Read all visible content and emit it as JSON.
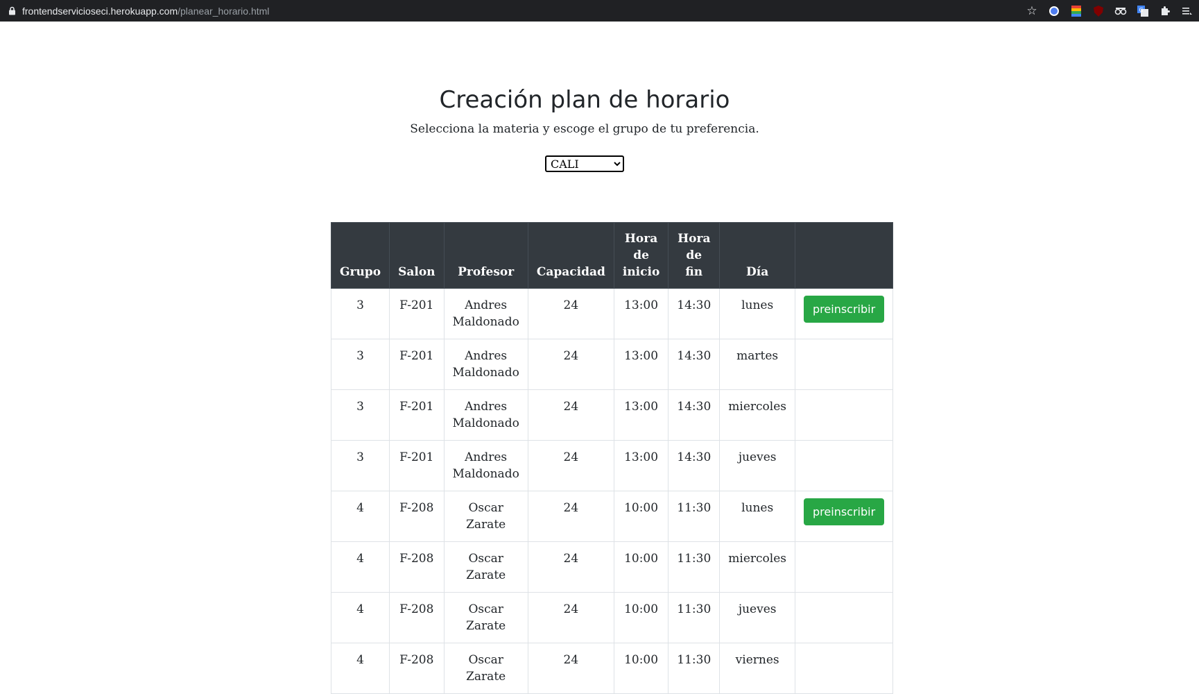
{
  "browser": {
    "url_host": "frontendservicioseci.herokuapp.com",
    "url_path": "/planear_horario.html"
  },
  "header": {
    "title": "Creación plan de horario",
    "subtitle": "Selecciona la materia y escoge el grupo de tu preferencia."
  },
  "city_select": {
    "selected": "CALI"
  },
  "table": {
    "columns": [
      "Grupo",
      "Salon",
      "Profesor",
      "Capacidad",
      "Hora de inicio",
      "Hora de fin",
      "Día",
      ""
    ],
    "rows": [
      {
        "grupo": "3",
        "salon": "F-201",
        "profesor": "Andres Maldonado",
        "capacidad": "24",
        "inicio": "13:00",
        "fin": "14:30",
        "dia": "lunes",
        "action": "preinscribir"
      },
      {
        "grupo": "3",
        "salon": "F-201",
        "profesor": "Andres Maldonado",
        "capacidad": "24",
        "inicio": "13:00",
        "fin": "14:30",
        "dia": "martes",
        "action": ""
      },
      {
        "grupo": "3",
        "salon": "F-201",
        "profesor": "Andres Maldonado",
        "capacidad": "24",
        "inicio": "13:00",
        "fin": "14:30",
        "dia": "miercoles",
        "action": ""
      },
      {
        "grupo": "3",
        "salon": "F-201",
        "profesor": "Andres Maldonado",
        "capacidad": "24",
        "inicio": "13:00",
        "fin": "14:30",
        "dia": "jueves",
        "action": ""
      },
      {
        "grupo": "4",
        "salon": "F-208",
        "profesor": "Oscar Zarate",
        "capacidad": "24",
        "inicio": "10:00",
        "fin": "11:30",
        "dia": "lunes",
        "action": "preinscribir"
      },
      {
        "grupo": "4",
        "salon": "F-208",
        "profesor": "Oscar Zarate",
        "capacidad": "24",
        "inicio": "10:00",
        "fin": "11:30",
        "dia": "miercoles",
        "action": ""
      },
      {
        "grupo": "4",
        "salon": "F-208",
        "profesor": "Oscar Zarate",
        "capacidad": "24",
        "inicio": "10:00",
        "fin": "11:30",
        "dia": "jueves",
        "action": ""
      },
      {
        "grupo": "4",
        "salon": "F-208",
        "profesor": "Oscar Zarate",
        "capacidad": "24",
        "inicio": "10:00",
        "fin": "11:30",
        "dia": "viernes",
        "action": ""
      }
    ]
  },
  "colors": {
    "header_bg": "#343a40",
    "button_bg": "#28a745"
  }
}
